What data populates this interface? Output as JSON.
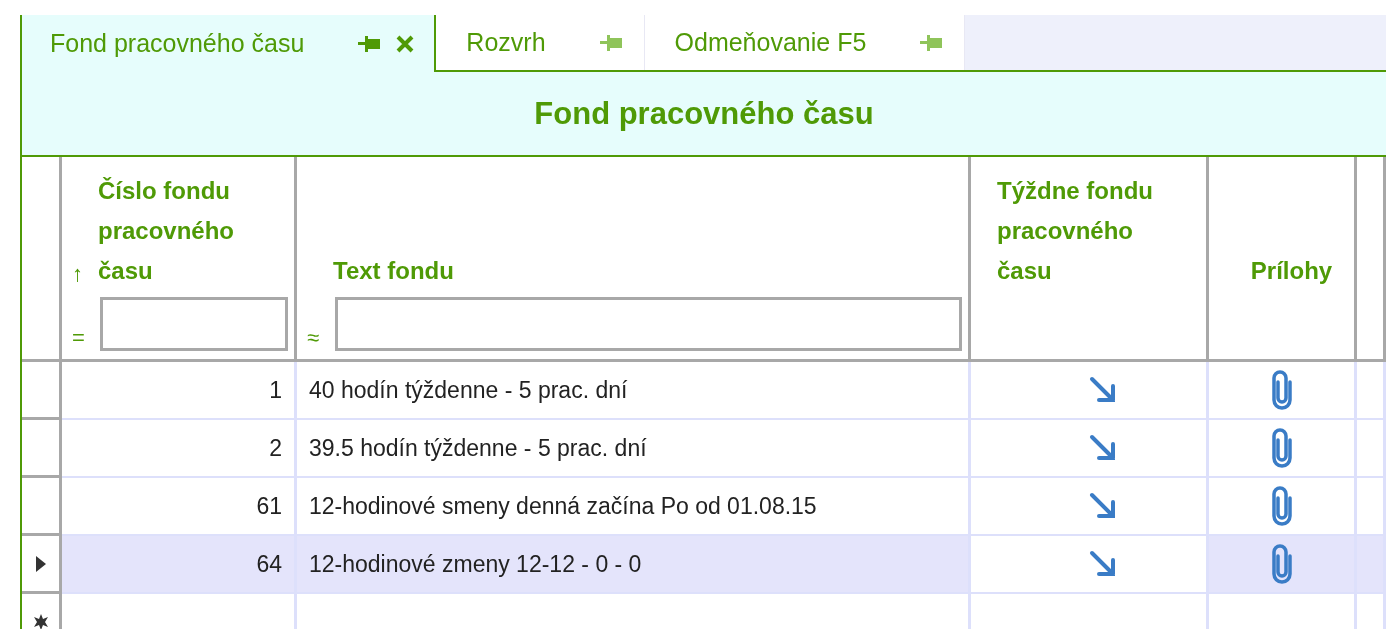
{
  "tabs": [
    {
      "label": "Fond pracovného času",
      "selected": true,
      "closable": true
    },
    {
      "label": "Rozvrh",
      "selected": false,
      "closable": false
    },
    {
      "label": "Odmeňovanie F5",
      "selected": false,
      "closable": false
    }
  ],
  "title": "Fond pracovného času",
  "table": {
    "columns": [
      {
        "label": "Číslo fondu pracovného času",
        "sort": "↑",
        "filter_prefix": "=",
        "kind": "number"
      },
      {
        "label": "Text fondu",
        "filter_prefix": "≈",
        "kind": "text"
      },
      {
        "label": "Týždne fondu pracovného času",
        "kind": "link"
      },
      {
        "label": "Prílohy",
        "kind": "attachment"
      }
    ],
    "rows": [
      {
        "number": "1",
        "text": "40 hodín týždenne - 5 prac. dní",
        "selected": false
      },
      {
        "number": "2",
        "text": "39.5 hodín týždenne -  5 prac. dní",
        "selected": false
      },
      {
        "number": "61",
        "text": "12-hodinové smeny denná začína Po od 01.08.15",
        "selected": false
      },
      {
        "number": "64",
        "text": "12-hodinové zmeny 12-12 - 0 - 0",
        "selected": true
      }
    ],
    "new_row": true
  }
}
